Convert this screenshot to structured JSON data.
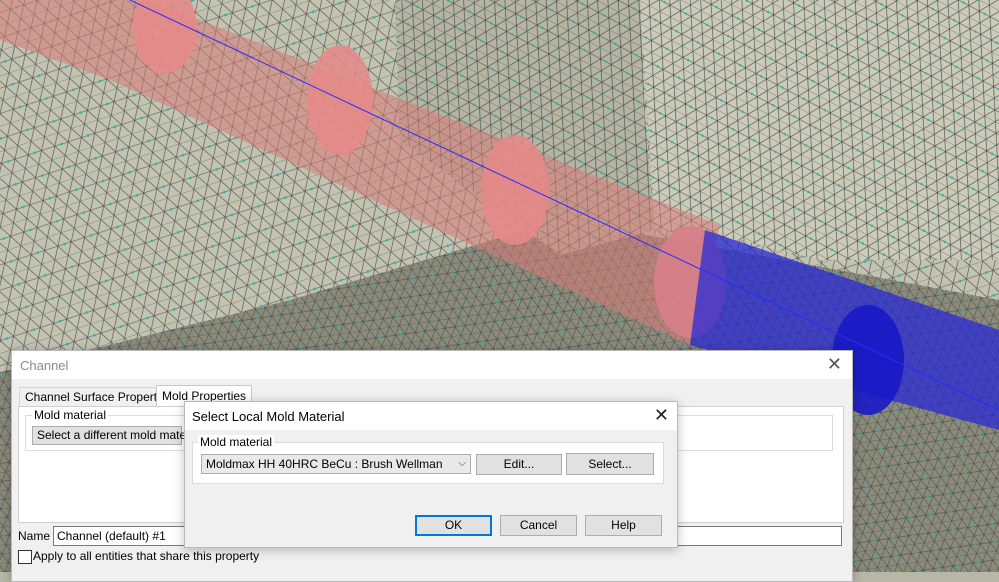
{
  "channel_dialog": {
    "title": "Channel",
    "tabs": [
      "Channel Surface Properties",
      "Mold Properties"
    ],
    "mold_material_group": "Mold material",
    "select_different_button": "Select a different mold material",
    "name_label": "Name",
    "name_value": "Channel (default) #1",
    "apply_all_label": "Apply to all entities that share this property"
  },
  "select_dialog": {
    "title": "Select Local Mold Material",
    "group_label": "Mold material",
    "material_selected": "Moldmax HH 40HRC BeCu : Brush Wellman",
    "edit_button": "Edit...",
    "select_button": "Select...",
    "ok_button": "OK",
    "cancel_button": "Cancel",
    "help_button": "Help"
  },
  "icons": {
    "close": "close-icon",
    "dropdown": "chevron-down-icon"
  },
  "colors": {
    "mesh_surface": "#c2c3b0",
    "mesh_edges": "#4a4a4a",
    "mesh_nodes": "#1fb5b5",
    "channel_pink": "#e07878",
    "channel_blue": "#1c1cd8",
    "focus_blue": "#0078d7"
  }
}
